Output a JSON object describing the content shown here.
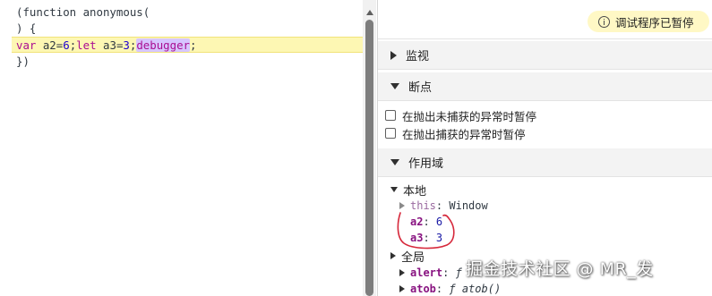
{
  "editor": {
    "line1": "(function anonymous(",
    "line2": ") {",
    "line3": {
      "kw_var": "var",
      "a2_decl": " a2=",
      "a2_value": "6",
      "sep1": ";",
      "kw_let": "let",
      "a3_decl": " a3=",
      "a3_value": "3",
      "sep2": ";",
      "kw_debugger": "debugger",
      "sep3": ";"
    },
    "line4": "})",
    "highlight_color": "#fdf7b3"
  },
  "status": {
    "paused_text": "调试程序已暂停",
    "badge_color": "#fff8c5"
  },
  "sections": {
    "watch": "监视",
    "breakpoints": "断点",
    "scope": "作用域"
  },
  "breakpoint_options": [
    "在抛出未捕获的异常时暂停",
    "在抛出捕获的异常时暂停"
  ],
  "scope": {
    "local": {
      "label": "本地",
      "this_name": "this",
      "this_value": "Window",
      "a2_name": "a2",
      "a2_value": "6",
      "a3_name": "a3",
      "a3_value": "3"
    },
    "global": {
      "label": "全局",
      "alert_name": "alert",
      "alert_value": "ƒ",
      "atob_name": "atob",
      "atob_value": "ƒ atob()"
    }
  },
  "separator": ":",
  "annotation_color": "#d6283b",
  "watermark": "掘金技术社区 @ MR_发"
}
